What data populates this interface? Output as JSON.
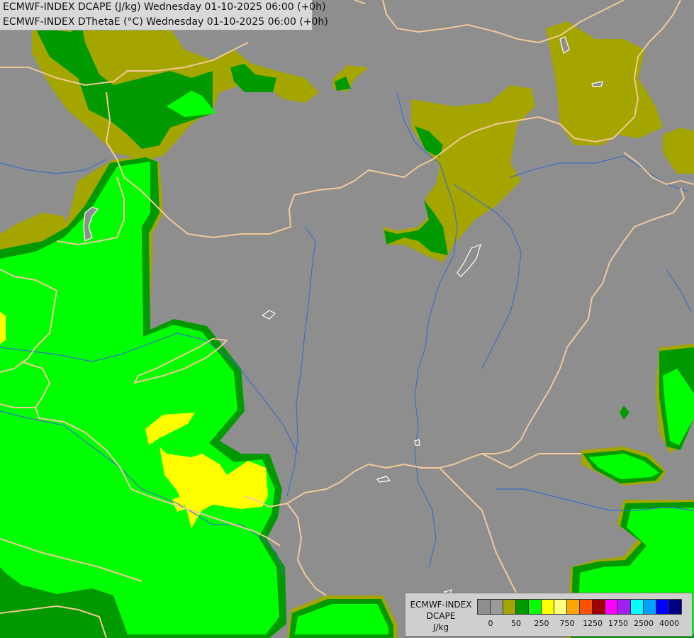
{
  "header": {
    "line1": "ECMWF-INDEX DCAPE (J/kg) Wednesday 01-10-2025 06:00 (+0h)",
    "line2": "ECMWF-INDEX DThetaE (°C) Wednesday 01-10-2025 06:00 (+0h)"
  },
  "map": {
    "background_color": "#8e8e8e",
    "border_color": "#f2c99a",
    "river_color": "#3d6fc4",
    "lake_outline_color": "#ffffff"
  },
  "legend": {
    "title": "ECMWF-INDEX",
    "variable": "DCAPE",
    "unit": "J/kg",
    "colors": [
      "#8e8e8e",
      "#9a9a9a",
      "#a5a500",
      "#009900",
      "#00ff00",
      "#ffff00",
      "#ffff80",
      "#ffa500",
      "#ff5000",
      "#a00000",
      "#ff00ff",
      "#a020f0",
      "#00ffff",
      "#00a0ff",
      "#0000ff",
      "#000080"
    ],
    "tick_labels": [
      {
        "text": "0",
        "index": 1
      },
      {
        "text": "50",
        "index": 3
      },
      {
        "text": "250",
        "index": 5
      },
      {
        "text": "750",
        "index": 7
      },
      {
        "text": "1250",
        "index": 9
      },
      {
        "text": "1750",
        "index": 11
      },
      {
        "text": "2500",
        "index": 13
      },
      {
        "text": "4000",
        "index": 15
      }
    ]
  }
}
